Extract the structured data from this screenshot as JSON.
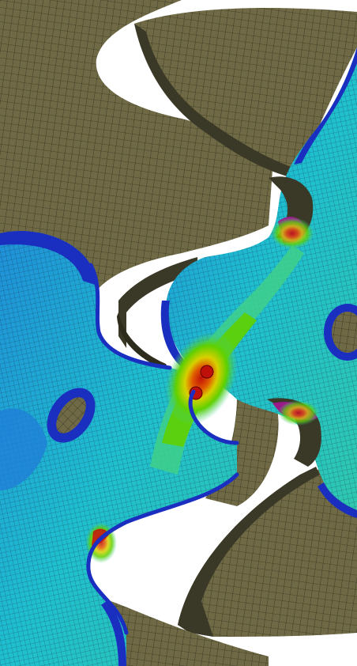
{
  "scene": {
    "description_type": "finite-element-contour-render",
    "colors": {
      "background": "#ffffff",
      "undeformed_mesh_fill": "#6f6a45",
      "undeformed_mesh_side": "#3a3826",
      "mesh_line": "#1d1d12",
      "contour_low": "#1a2fbf",
      "contour_low_mid": "#1f7fd8",
      "contour_mid": "#1fbfcf",
      "contour_mid_high": "#3fd08a",
      "contour_high": "#5fd000",
      "contour_higher": "#d8d000",
      "contour_peak": "#c0100a",
      "contour_hot_edge": "#9a1a8a"
    },
    "legend": []
  }
}
